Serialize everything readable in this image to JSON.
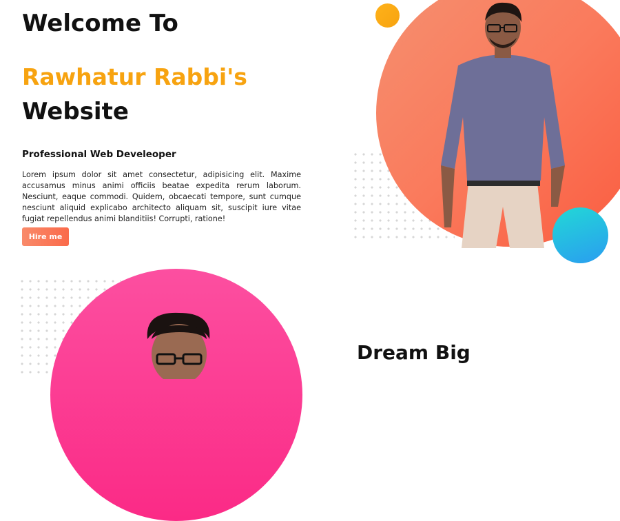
{
  "hero": {
    "line1": "Welcome To",
    "name": "Rawhatur Rabbi's",
    "line3": "Website",
    "role": "Professional Web Develeoper",
    "description": "Lorem ipsum dolor sit amet consectetur, adipisicing elit. Maxime accusamus minus animi officiis beatae expedita rerum laborum. Nesciunt, eaque commodi. Quidem, obcaecati tempore, sunt cumque nesciunt aliquid explicabo architecto aliquam sit, suscipit iure vitae fugiat repellendus animi blanditiis! Corrupti, ratione!",
    "cta_label": "Hire me"
  },
  "section2": {
    "title": "Dream Big"
  },
  "colors": {
    "accent_orange": "#f7a310",
    "button_gradient_start": "#f98a6a",
    "button_gradient_end": "#fa6a4a",
    "hero_circle": "#fa7a5c",
    "pink_circle": "#fb2a86",
    "teal_circle_start": "#22d8d6",
    "teal_circle_end": "#2a9df0"
  }
}
